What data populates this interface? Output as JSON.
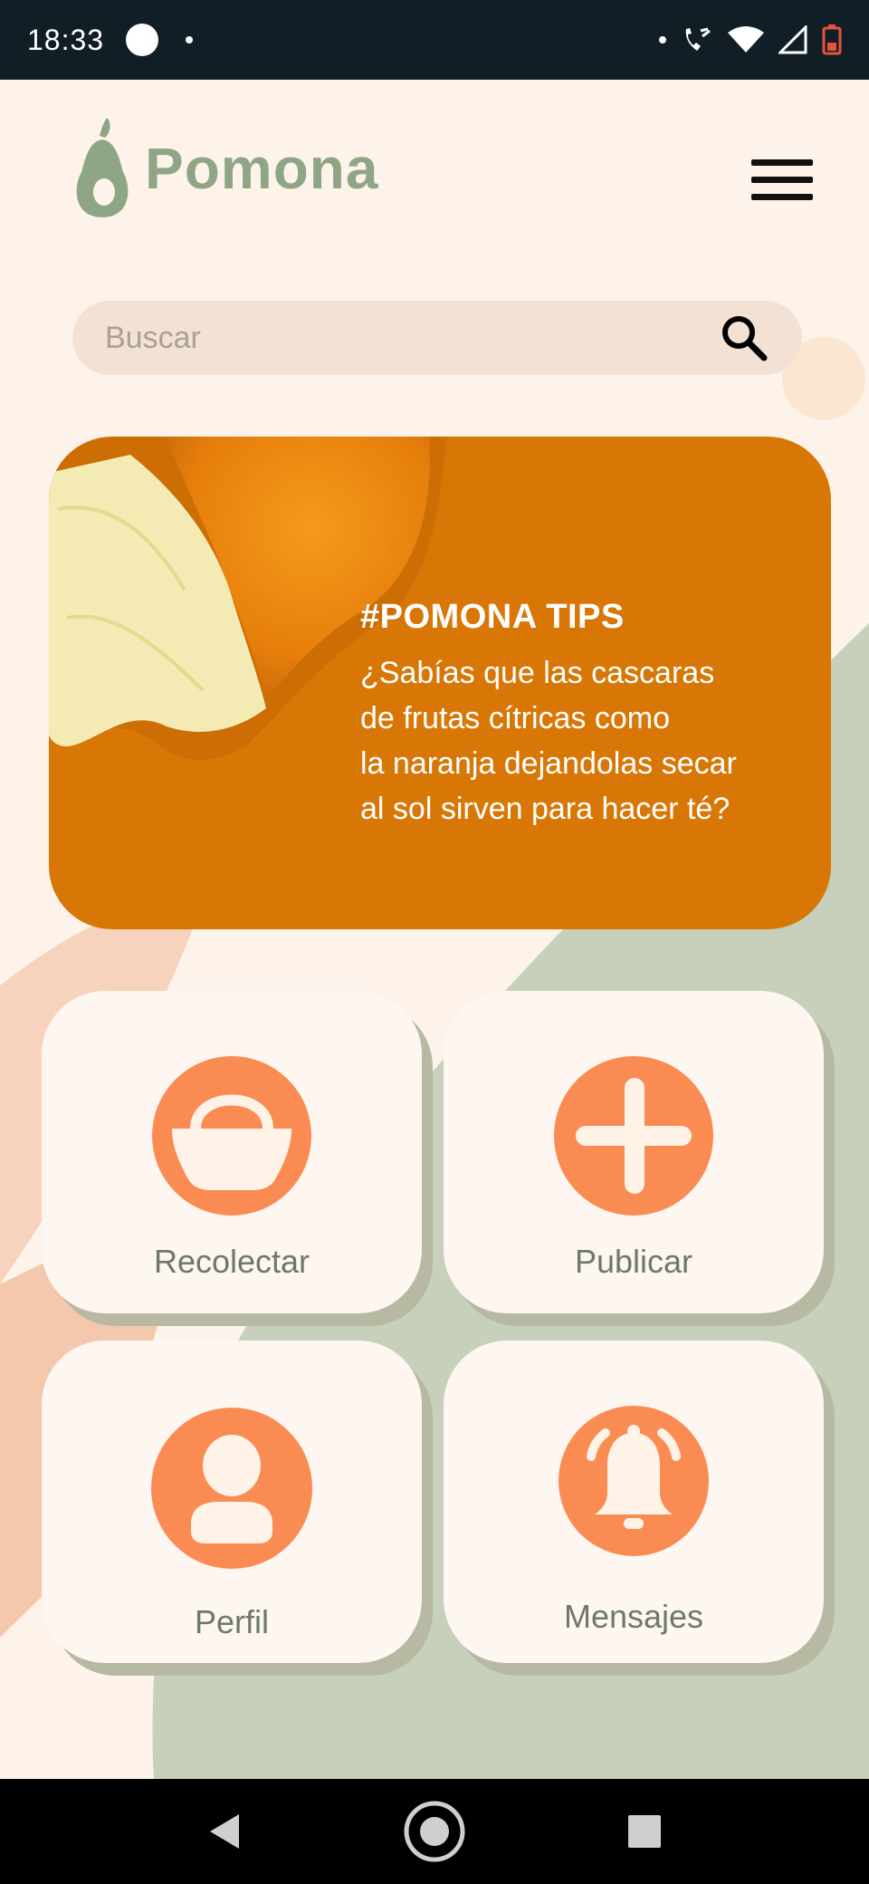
{
  "status_bar": {
    "time": "18:33"
  },
  "app": {
    "name": "Pomona"
  },
  "search": {
    "placeholder": "Buscar"
  },
  "tip": {
    "title": "#POMONA TIPS",
    "lines": [
      "¿Sabías que las cascaras",
      "de frutas cítricas como",
      "la naranja dejandolas secar",
      "al sol sirven para hacer té?"
    ]
  },
  "tiles": {
    "collect": {
      "label": "Recolectar",
      "icon": "basket-icon"
    },
    "publish": {
      "label": "Publicar",
      "icon": "plus-icon"
    },
    "profile": {
      "label": "Perfil",
      "icon": "user-icon"
    },
    "messages": {
      "label": "Mensajes",
      "icon": "bell-icon"
    }
  },
  "colors": {
    "brand_green": "#8fa686",
    "accent_orange": "#fa8c53",
    "tip_orange": "#d97706",
    "background": "#fdf3ea",
    "tile": "#fef6f0"
  }
}
